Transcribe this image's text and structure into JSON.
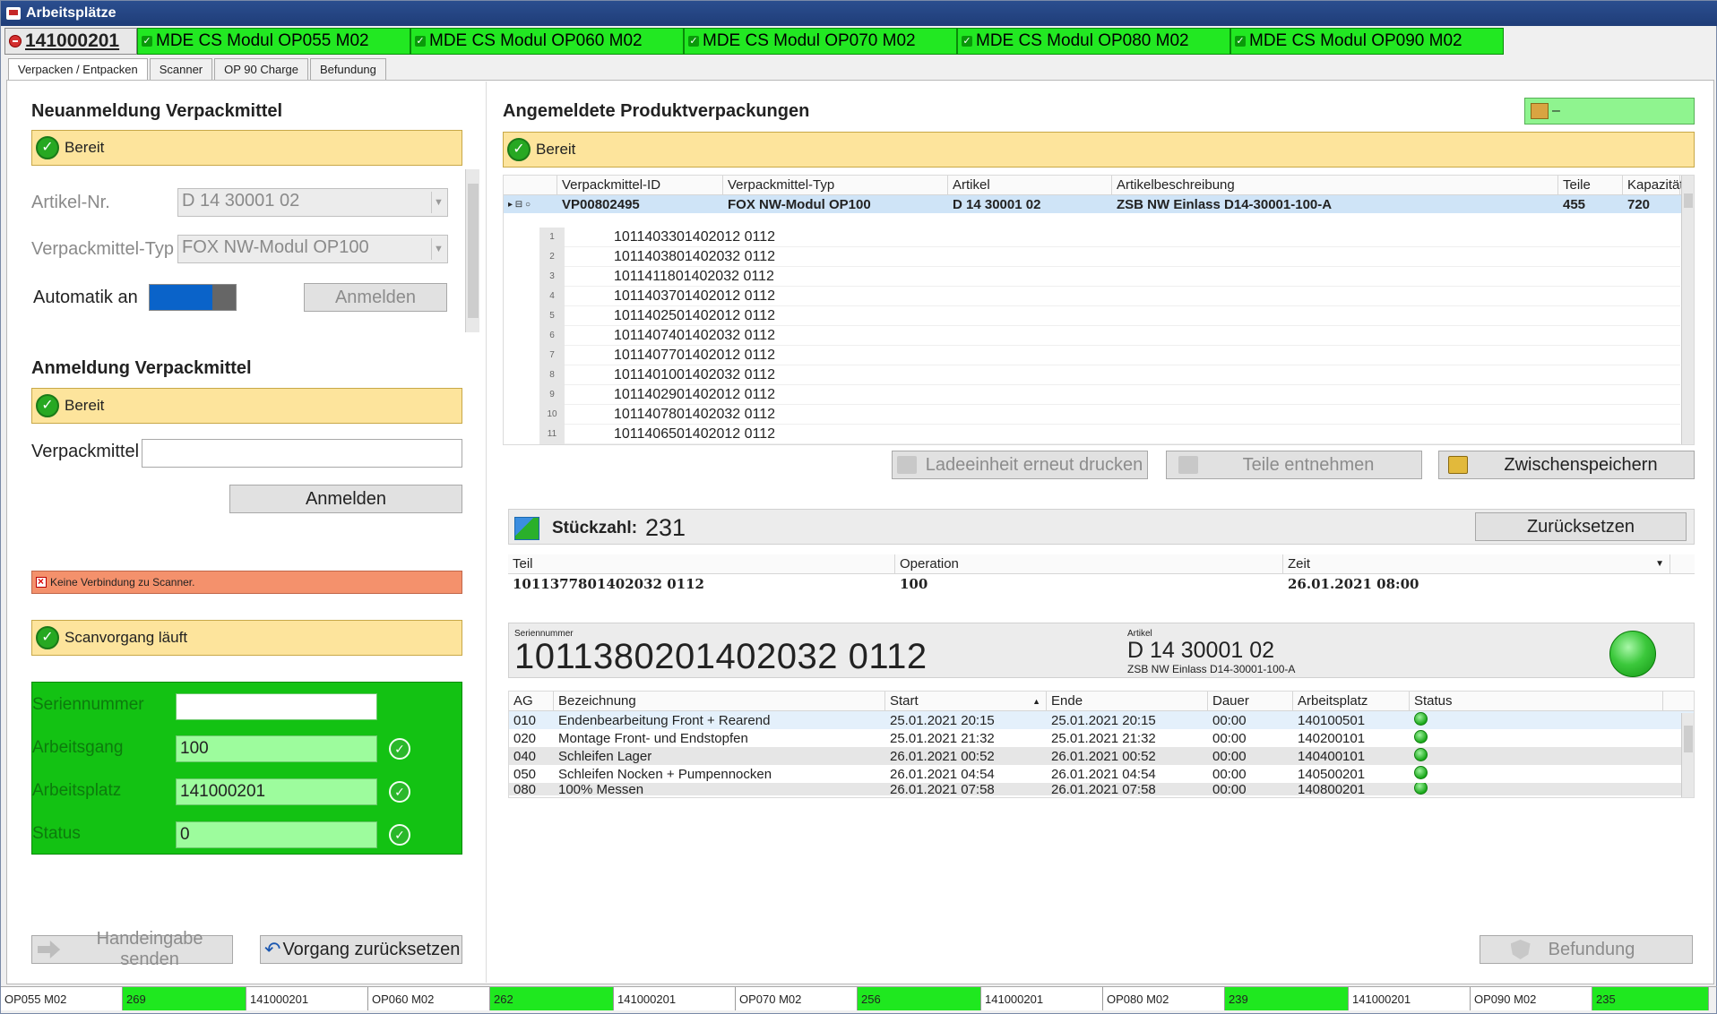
{
  "window": {
    "title": "Arbeitsplätze"
  },
  "stations": {
    "main": "141000201",
    "tabs": [
      "MDE CS Modul OP055 M02",
      "MDE CS Modul OP060 M02",
      "MDE CS Modul OP070 M02",
      "MDE CS Modul OP080 M02",
      "MDE CS Modul OP090 M02"
    ]
  },
  "subtabs": [
    "Verpacken / Entpacken",
    "Scanner",
    "OP 90 Charge",
    "Befundung"
  ],
  "left": {
    "neu_title": "Neuanmeldung Verpackmittel",
    "neu_status": "Bereit",
    "artikel_label": "Artikel-Nr.",
    "artikel_value": "D 14 30001 02",
    "typ_label": "Verpackmittel-Typ",
    "typ_value": "FOX NW-Modul OP100",
    "automatik_label": "Automatik an",
    "anmelden_1": "Anmelden",
    "anm_title": "Anmeldung Verpackmittel",
    "anm_status": "Bereit",
    "verpackmittel_label": "Verpackmittel",
    "verpackmittel_value": "",
    "anmelden_2": "Anmelden",
    "scanner_error": "Keine Verbindung zu Scanner.",
    "scan_status": "Scanvorgang läuft",
    "fields": {
      "seriennummer_label": "Seriennummer",
      "seriennummer_value": "",
      "arbeitsgang_label": "Arbeitsgang",
      "arbeitsgang_value": "100",
      "arbeitsplatz_label": "Arbeitsplatz",
      "arbeitsplatz_value": "141000201",
      "status_label": "Status",
      "status_value": "0"
    },
    "handeingabe": "Handeingabe senden",
    "vorgang": "Vorgang zurücksetzen"
  },
  "right": {
    "title": "Angemeldete Produktverpackungen",
    "top_badge": "–",
    "status": "Bereit",
    "grid": {
      "headers": [
        "Verpackmittel-ID",
        "Verpackmittel-Typ",
        "Artikel",
        "Artikelbeschreibung",
        "Teile",
        "Kapazität"
      ],
      "row": [
        "VP00802495",
        "FOX NW-Modul OP100",
        "D 14 30001 02",
        "ZSB NW Einlass D14-30001-100-A",
        "455",
        "720"
      ],
      "subrows": [
        "1011403301402012 0112",
        "1011403801402032 0112",
        "1011411801402032 0112",
        "1011403701402012 0112",
        "1011402501402012 0112",
        "1011407401402032 0112",
        "1011407701402012 0112",
        "1011401001402032 0112",
        "1011402901402012 0112",
        "1011407801402032 0112",
        "1011406501402012 0112"
      ]
    },
    "btn_ladeeinheit": "Ladeeinheit erneut drucken",
    "btn_teile": "Teile entnehmen",
    "btn_zwischen": "Zwischenspeichern",
    "stueck_label": "Stückzahl:",
    "stueck_value": "231",
    "btn_zuruecksetzen": "Zurücksetzen",
    "last": {
      "headers": [
        "Teil",
        "Operation",
        "Zeit"
      ],
      "row": [
        "1011377801402032 0112",
        "100",
        "26.01.2021 08:00"
      ]
    },
    "serial": {
      "label": "Seriennummer",
      "value": "1011380201402032 0112",
      "artikel_label": "Artikel",
      "artikel_value": "D 14 30001 02",
      "artikel_desc": "ZSB NW Einlass D14-30001-100-A"
    },
    "ops": {
      "headers": [
        "AG",
        "Bezeichnung",
        "Start",
        "Ende",
        "Dauer",
        "Arbeitsplatz",
        "Status"
      ],
      "rows": [
        [
          "010",
          "Endenbearbeitung Front + Rearend",
          "25.01.2021 20:15",
          "25.01.2021 20:15",
          "00:00",
          "140100501"
        ],
        [
          "020",
          "Montage Front- und Endstopfen",
          "25.01.2021 21:32",
          "25.01.2021 21:32",
          "00:00",
          "140200101"
        ],
        [
          "040",
          "Schleifen Lager",
          "26.01.2021 00:52",
          "26.01.2021 00:52",
          "00:00",
          "140400101"
        ],
        [
          "050",
          "Schleifen Nocken + Pumpennocken",
          "26.01.2021 04:54",
          "26.01.2021 04:54",
          "00:00",
          "140500201"
        ],
        [
          "080",
          "100% Messen",
          "26.01.2021 07:58",
          "26.01.2021 07:58",
          "00:00",
          "140800201"
        ]
      ]
    },
    "btn_befundung": "Befundung"
  },
  "bottom": [
    [
      "OP055 M02",
      "269",
      "141000201"
    ],
    [
      "OP060 M02",
      "262",
      "141000201"
    ],
    [
      "OP070 M02",
      "256",
      "141000201"
    ],
    [
      "OP080 M02",
      "239",
      "141000201"
    ],
    [
      "OP090 M02",
      "235"
    ]
  ]
}
